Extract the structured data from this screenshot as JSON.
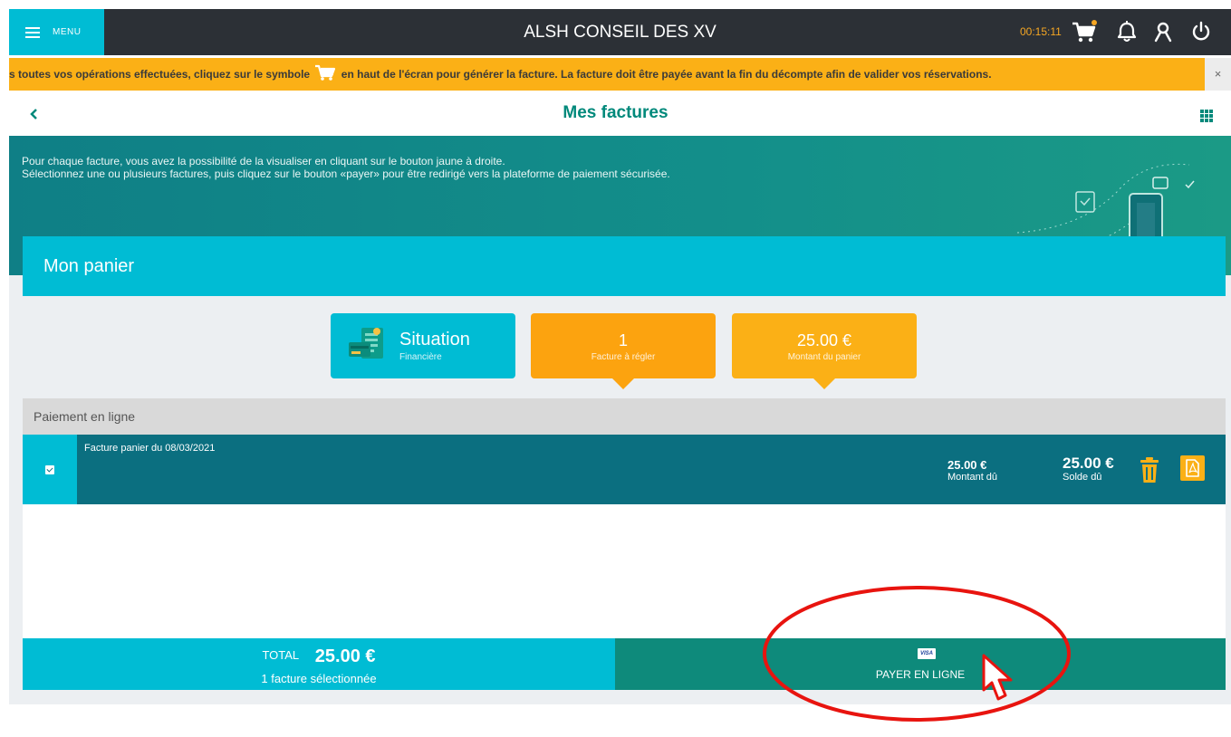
{
  "topbar": {
    "menu_label": "MENU",
    "app_title": "ALSH CONSEIL DES XV",
    "timer": "00:15:11",
    "cart_badge_color": "#f5a623",
    "icons": [
      "cart-icon",
      "bell-icon",
      "user-icon",
      "power-icon"
    ]
  },
  "banner": {
    "text_before_icon": "s toutes vos opérations effectuées, cliquez sur le symbole",
    "text_after_icon": "en haut de l'écran pour générer la facture. La facture doit être payée avant la fin du décompte afin de valider vos réservations.",
    "close_label": "×"
  },
  "page": {
    "title": "Mes factures",
    "back_icon": "chevron-left-icon",
    "apps_icon": "grid-icon"
  },
  "hero": {
    "line1": "Pour chaque facture, vous avez la possibilité de la visualiser en cliquant sur le bouton jaune à droite.",
    "line2": "Sélectionnez une ou plusieurs factures, puis cliquez sur le bouton «payer» pour être redirigé vers la plateforme de paiement sécurisée."
  },
  "panier": {
    "title": "Mon panier",
    "cards": {
      "situation_title": "Situation",
      "situation_sub": "Financière",
      "count_value": "1",
      "count_label": "Facture à régler",
      "amount_value": "25.00 €",
      "amount_label": "Montant du panier"
    }
  },
  "payment": {
    "section_title": "Paiement en ligne",
    "invoices": [
      {
        "label": "Facture panier du 08/03/2021",
        "selected": true,
        "amount_due": "25.00 €",
        "amount_due_label": "Montant dû",
        "balance_due": "25.00 €",
        "balance_due_label": "Solde dû"
      }
    ],
    "total_label": "TOTAL",
    "total_value": "25.00 €",
    "total_sub": "1 facture sélectionnée",
    "pay_button_label": "PAYER EN LIGNE",
    "card_logo_text": "VISA"
  },
  "colors": {
    "primary_cyan": "#00bcd4",
    "teal": "#00897b",
    "orange": "#fca30f",
    "yellow": "#fbb016",
    "dark_bar": "#2c3036",
    "annotation_red": "#e8140f"
  }
}
